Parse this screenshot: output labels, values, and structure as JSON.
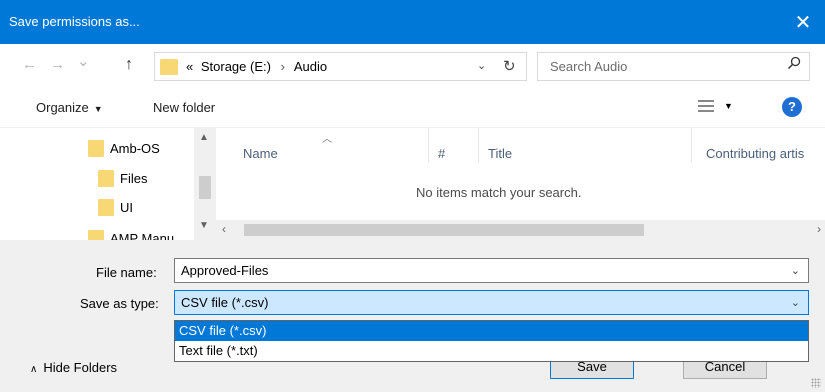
{
  "window": {
    "title": "Save permissions as...",
    "close_glyph": "✕"
  },
  "nav": {
    "back_glyph": "←",
    "forward_glyph": "→",
    "recent_glyph": "⌄",
    "up_glyph": "↑"
  },
  "address": {
    "overflow": "«",
    "crumbs": [
      "Storage (E:)",
      "Audio"
    ],
    "separator": "›",
    "dropdown_glyph": "⌄",
    "refresh_glyph": "↻"
  },
  "search": {
    "placeholder": "Search Audio",
    "icon": "search-icon"
  },
  "toolbar": {
    "organize_label": "Organize",
    "caret": "▼",
    "new_folder_label": "New folder",
    "help_glyph": "?"
  },
  "tree": {
    "items": [
      {
        "label": "Amb-OS"
      },
      {
        "label": "Files"
      },
      {
        "label": "UI"
      },
      {
        "label": "AMP Manu..."
      }
    ]
  },
  "file_list": {
    "columns": [
      "Name",
      "#",
      "Title",
      "Contributing artis"
    ],
    "empty_message": "No items match your search."
  },
  "form": {
    "file_name_label": "File name:",
    "file_name_value": "Approved-Files",
    "save_type_label": "Save as type:",
    "save_type_value": "CSV file (*.csv)",
    "dropdown_options": [
      "CSV file (*.csv)",
      "Text file (*.txt)"
    ],
    "highlighted_option": 0
  },
  "footer": {
    "hide_folders_label": "Hide Folders",
    "save_label": "Save",
    "cancel_label": "Cancel"
  },
  "colors": {
    "titlebar": "#0078d7",
    "folder": "#f8d775",
    "highlight": "#0078d7",
    "selected_field": "#cce8ff"
  }
}
